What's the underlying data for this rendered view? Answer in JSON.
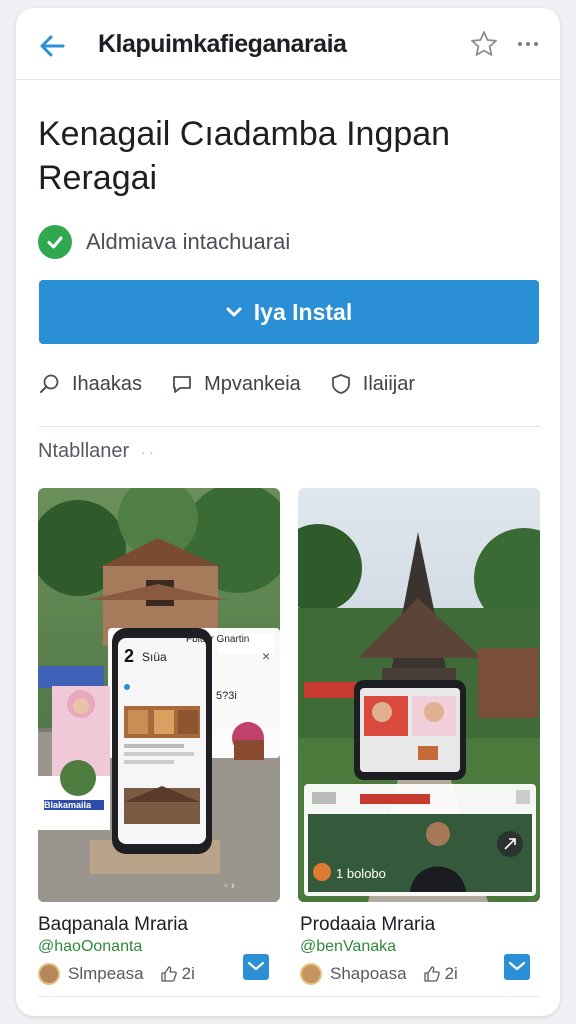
{
  "header": {
    "app_title": "Klapuimkafieganaraia",
    "back_icon": "arrow-left-icon",
    "favorite_icon": "star-icon",
    "more_icon": "more-horizontal-icon"
  },
  "app": {
    "headline": "Kenagail Cıadamba Ingpan Reragai",
    "verified_text": "Aldmiava intachuarai",
    "install_label": "Iya Instal"
  },
  "actions": [
    {
      "label": "Ihaakas",
      "icon": "search-icon"
    },
    {
      "label": "Mpvankeia",
      "icon": "chat-icon"
    },
    {
      "label": "Ilaiijar",
      "icon": "shield-icon"
    }
  ],
  "section": {
    "label": "Ntabllaner"
  },
  "media": {
    "m1": {
      "panel_header": "Fbiusr Gnartin",
      "phone_number": "2",
      "phone_title": "Sıüa",
      "phone_count": "5?3i",
      "sign_text": "Blakamaila"
    },
    "m2": {
      "badge": "1 bolobo"
    }
  },
  "posts": [
    {
      "title": "Baqpanala Mraria",
      "handle": "@haoOonanta",
      "author": "Slmpeasa",
      "likes": "2i"
    },
    {
      "title": "Prodaaia Mraria",
      "handle": "@benVanaka",
      "author": "Shapoasa",
      "likes": "2i"
    }
  ],
  "colors": {
    "accent": "#2a8fd4",
    "verified": "#2fa84f",
    "handle": "#2f8a3b"
  }
}
